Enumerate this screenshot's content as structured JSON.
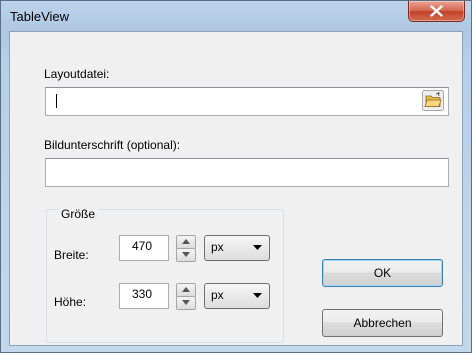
{
  "window": {
    "title": "TableView"
  },
  "layout_file": {
    "label": "Layoutdatei:",
    "value": ""
  },
  "caption": {
    "label": "Bildunterschrift (optional):",
    "value": ""
  },
  "size_group": {
    "legend": "Größe",
    "width": {
      "label": "Breite:",
      "value": "470",
      "unit": "px"
    },
    "height": {
      "label": "Höhe:",
      "value": "330",
      "unit": "px"
    }
  },
  "buttons": {
    "ok": "OK",
    "cancel": "Abbrechen"
  },
  "icons": {
    "close": "close-icon",
    "folder": "folder-open-icon",
    "spin_up": "triangle-up-icon",
    "spin_down": "triangle-down-icon",
    "dropdown": "triangle-down-icon"
  }
}
